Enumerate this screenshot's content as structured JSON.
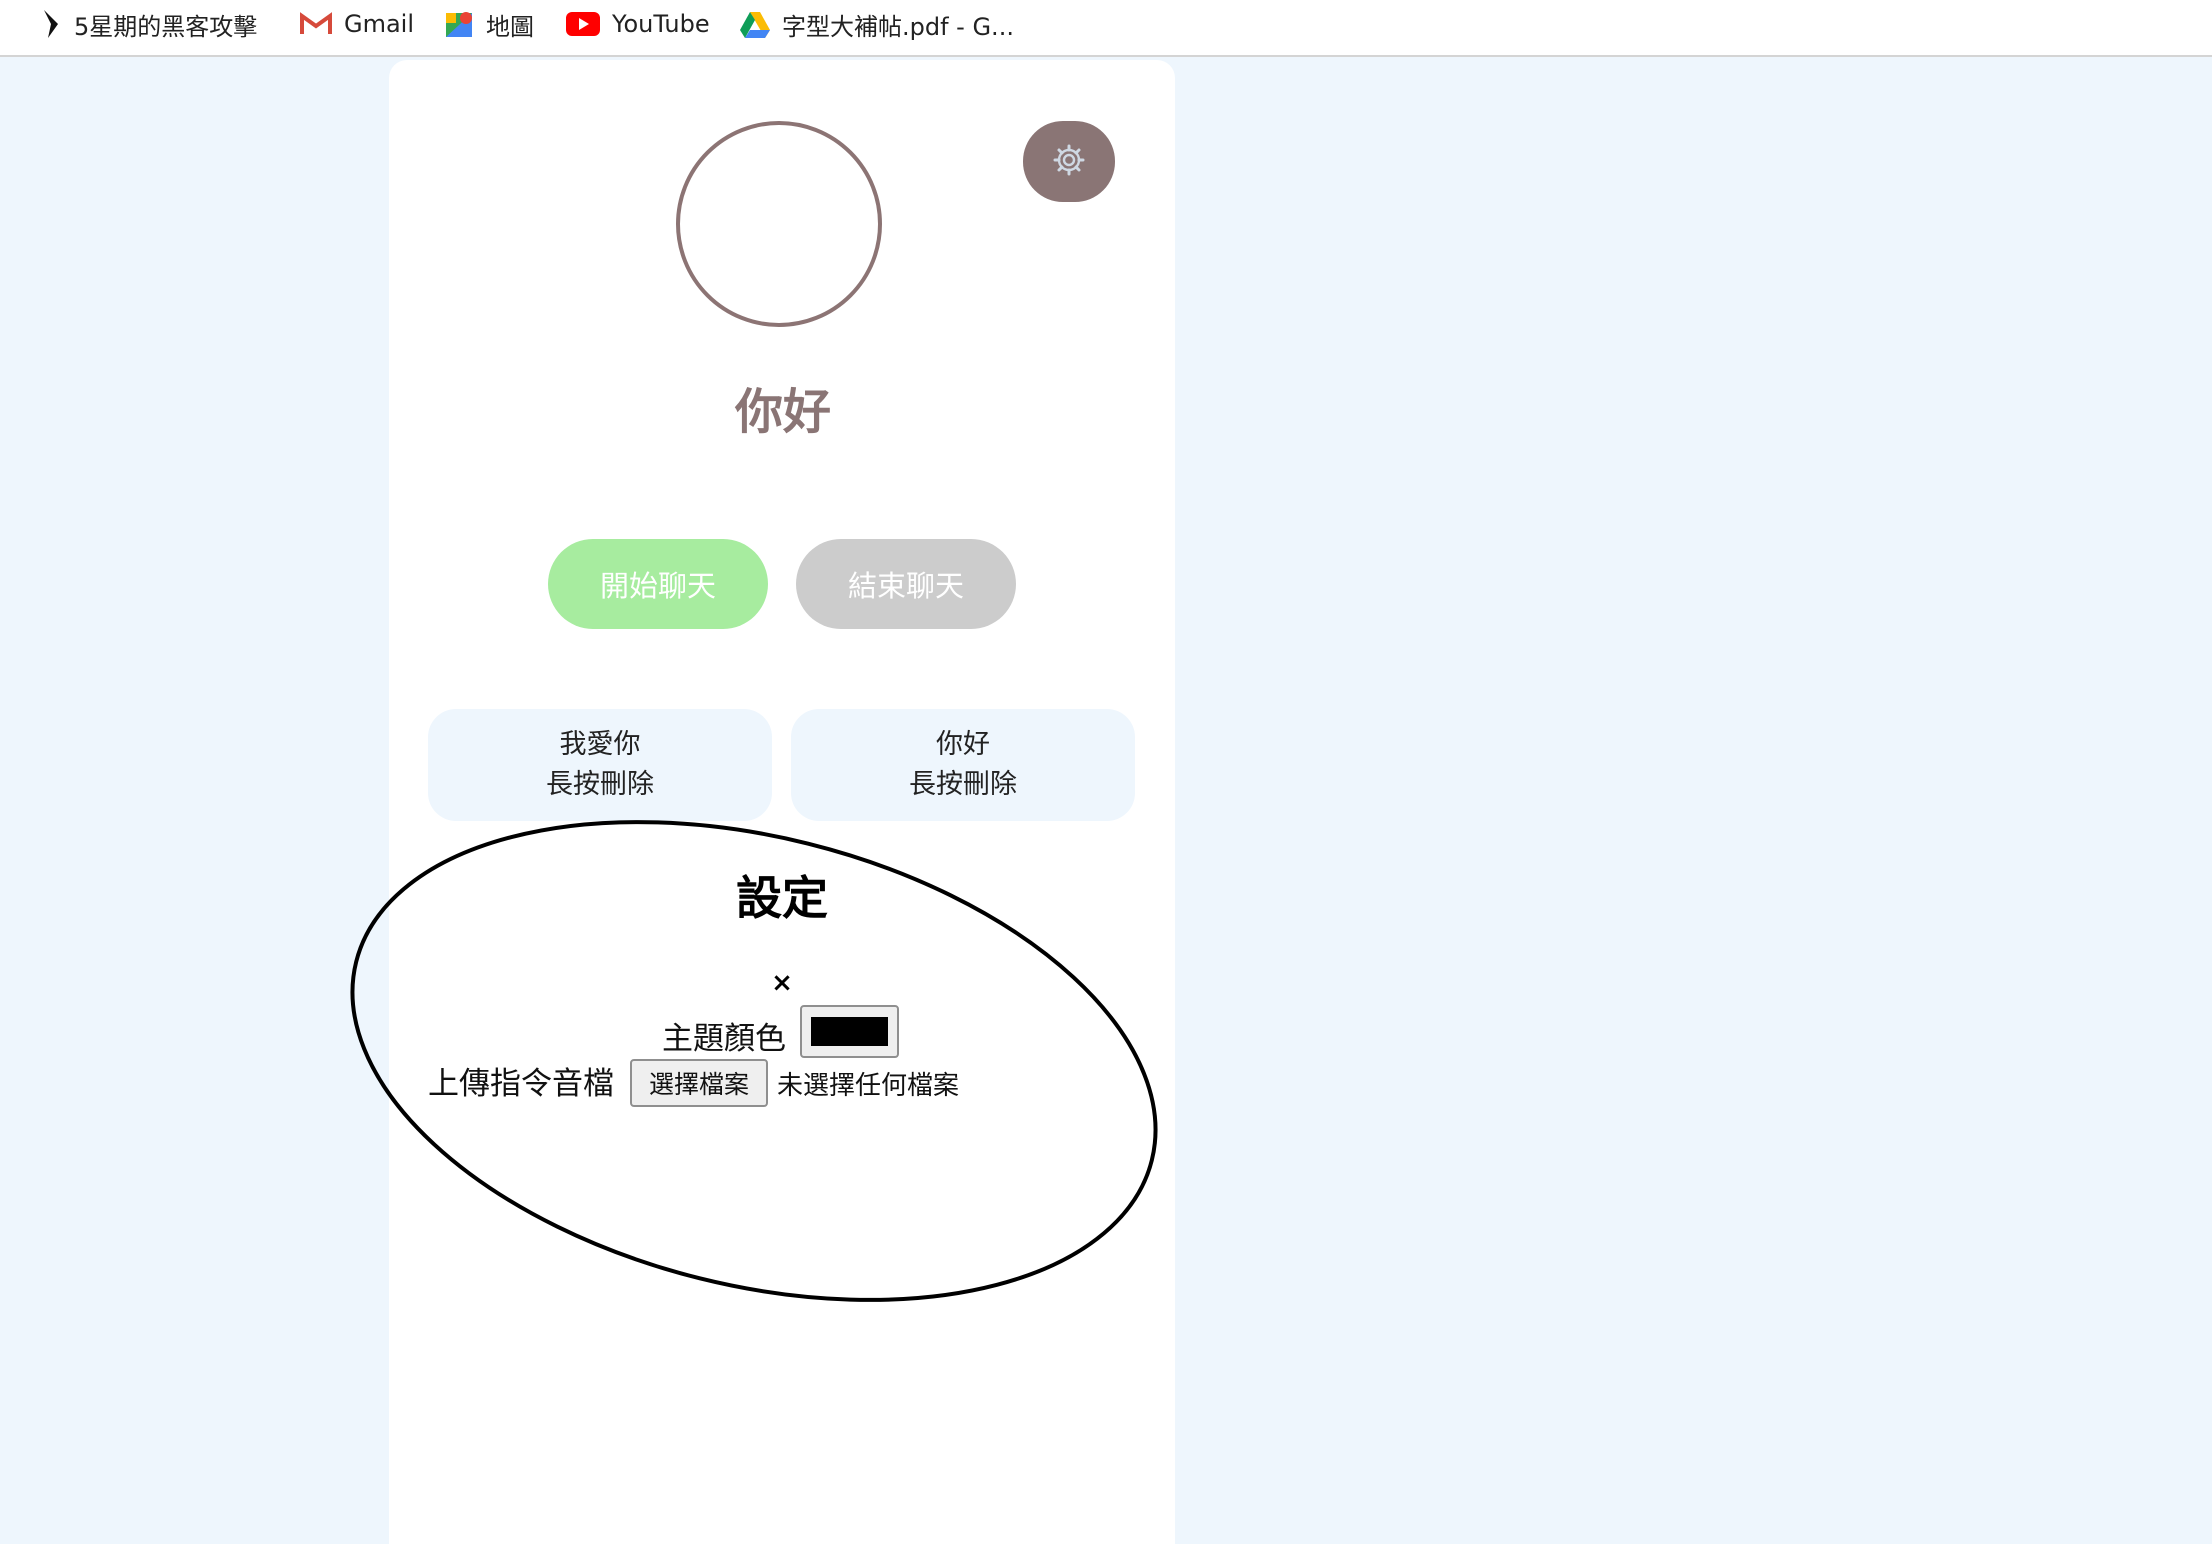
{
  "bookmarks": [
    {
      "label": "5星期的黑客攻擊",
      "icon": "arrow-logo-icon"
    },
    {
      "label": "Gmail",
      "icon": "gmail-icon"
    },
    {
      "label": "地圖",
      "icon": "maps-icon"
    },
    {
      "label": "YouTube",
      "icon": "youtube-icon"
    },
    {
      "label": "字型大補帖.pdf - G...",
      "icon": "drive-icon"
    }
  ],
  "header": {
    "greeting": "你好",
    "settings_icon": "gear-icon"
  },
  "controls": {
    "start_label": "開始聊天",
    "end_label": "結束聊天"
  },
  "commands": [
    {
      "phrase": "我愛你",
      "hint": "長按刪除"
    },
    {
      "phrase": "你好",
      "hint": "長按刪除"
    }
  ],
  "settings": {
    "title": "設定",
    "close": "×",
    "theme_label": "主題顏色",
    "theme_color": "#000000",
    "upload_label": "上傳指令音檔",
    "file_button": "選擇檔案",
    "file_status": "未選擇任何檔案"
  },
  "colors": {
    "accent": "#8a7575",
    "start": "#a7ec9f",
    "end": "#cccccc",
    "chip_bg": "#eef6fd"
  }
}
